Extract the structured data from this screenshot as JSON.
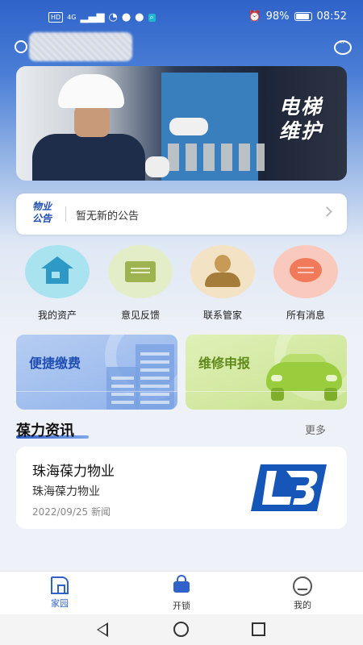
{
  "status_bar": {
    "network_chips": [
      "HD",
      "4G"
    ],
    "battery": "98%",
    "time": "08:52"
  },
  "banner": {
    "line1": "电梯",
    "line2": "维护"
  },
  "notice": {
    "badge_line1": "物业",
    "badge_line2": "公告",
    "text": "暂无新的公告"
  },
  "quick_actions": [
    {
      "label": "我的资产",
      "icon": "house-icon"
    },
    {
      "label": "意见反馈",
      "icon": "envelope-icon"
    },
    {
      "label": "联系管家",
      "icon": "person-icon"
    },
    {
      "label": "所有消息",
      "icon": "chat-bubble-icon"
    }
  ],
  "cards": {
    "pay": "便捷缴费",
    "repair": "维修申报"
  },
  "news": {
    "section_title": "葆力资讯",
    "more": "更多",
    "items": [
      {
        "title": "珠海葆力物业",
        "subtitle": "珠海葆力物业",
        "date": "2022/09/25 新闻"
      }
    ]
  },
  "tabs": [
    {
      "label": "家园",
      "icon": "home-icon"
    },
    {
      "label": "开锁",
      "icon": "lock-icon"
    },
    {
      "label": "我的",
      "icon": "profile-icon"
    }
  ],
  "colors": {
    "brand": "#2f63c9",
    "logo_blue": "#1656b8"
  }
}
